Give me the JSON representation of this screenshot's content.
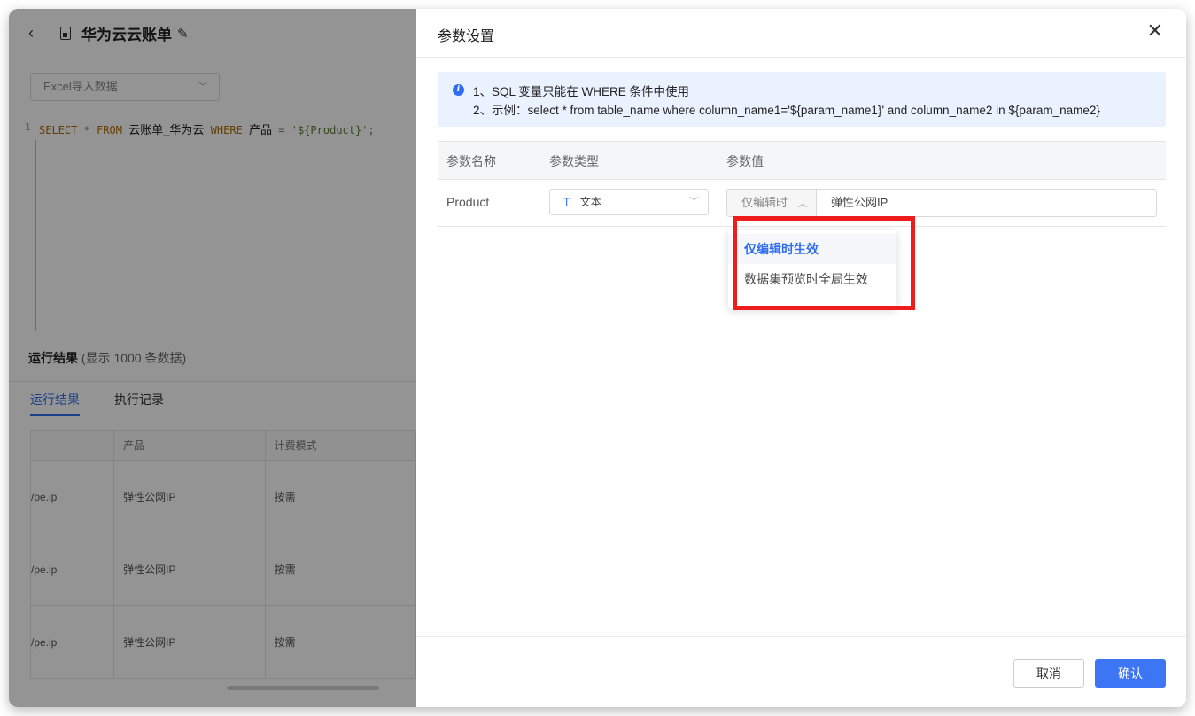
{
  "left_page": {
    "title": "华为云云账单",
    "datasource": "Excel导入数据",
    "sql": {
      "line_no": "1",
      "kw_select": "SELECT",
      "star": "*",
      "kw_from": "FROM",
      "table": "云账单_华为云",
      "kw_where": "WHERE",
      "column": "产品",
      "eq": "=",
      "value": "'${Product}'",
      "semicolon": ";"
    },
    "results_title": "运行结果",
    "results_sub": "(显示 1000 条数据)",
    "tabs": [
      "运行结果",
      "执行记录"
    ],
    "table": {
      "headers": [
        "",
        "产品",
        "计费模式"
      ],
      "rows": [
        [
          "/pe.ip",
          "弹性公网IP",
          "按需"
        ],
        [
          "/pe.ip",
          "弹性公网IP",
          "按需"
        ],
        [
          "/pe.ip",
          "弹性公网IP",
          "按需"
        ]
      ]
    }
  },
  "drawer": {
    "title": "参数设置",
    "notice": {
      "line1": "1、SQL 变量只能在 WHERE 条件中使用",
      "line2": "2、示例：select * from table_name where column_name1='${param_name1}' and column_name2 in ${param_name2}"
    },
    "columns": [
      "参数名称",
      "参数类型",
      "参数值"
    ],
    "param": {
      "name": "Product",
      "type_icon": "T",
      "type": "文本",
      "scope": "仅编辑时",
      "value": "弹性公网IP"
    },
    "dropdown_options": [
      "仅编辑时生效",
      "数据集预览时全局生效"
    ],
    "cancel_label": "取消",
    "confirm_label": "确认"
  },
  "colors": {
    "accent": "#3d76f5",
    "highlight": "#ee1c1c",
    "notice_bg": "#eaf1ff"
  }
}
